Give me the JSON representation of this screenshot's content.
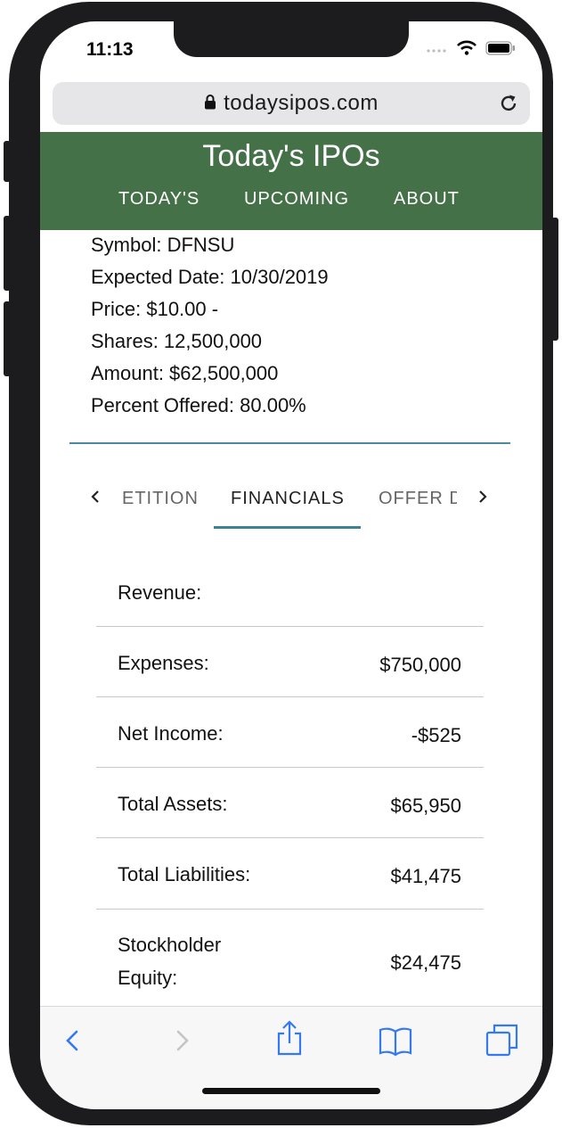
{
  "status_bar": {
    "time": "11:13"
  },
  "browser": {
    "url": "todaysipos.com"
  },
  "site": {
    "title": "Today's IPOs",
    "nav": [
      "TODAY'S",
      "UPCOMING",
      "ABOUT"
    ]
  },
  "ipo": {
    "symbol": "Symbol: DFNSU",
    "expected_date": "Expected Date: 10/30/2019",
    "price": "Price: $10.00 -",
    "shares": "Shares: 12,500,000",
    "amount": "Amount: $62,500,000",
    "percent_offered": "Percent Offered: 80.00%"
  },
  "tabs": {
    "prev_partial": "ETITION",
    "active": "FINANCIALS",
    "next_partial": "OFFER D"
  },
  "financials": [
    {
      "label": "Revenue:",
      "value": ""
    },
    {
      "label": "Expenses:",
      "value": "$750,000"
    },
    {
      "label": "Net Income:",
      "value": "-$525"
    },
    {
      "label": "Total Assets:",
      "value": "$65,950"
    },
    {
      "label": "Total Liabilities:",
      "value": "$41,475"
    },
    {
      "label": "Stockholder Equity:",
      "value": "$24,475"
    }
  ],
  "colors": {
    "header_green": "#457148",
    "tab_accent": "#3a8294",
    "ios_blue": "#3478f6"
  },
  "icons": {
    "toolbar": [
      "back-chevron-icon",
      "forward-chevron-icon",
      "share-icon",
      "bookmarks-icon",
      "tabs-icon"
    ]
  }
}
